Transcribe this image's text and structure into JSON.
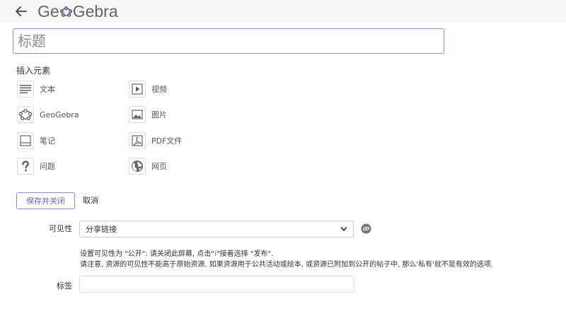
{
  "header": {
    "back_icon": "arrow-left-icon",
    "logo_left": "Ge",
    "logo_right": "Gebra",
    "logo_color": "#666666"
  },
  "title_field": {
    "placeholder": "标题",
    "value": ""
  },
  "insert_section": {
    "title": "插入元素",
    "items": [
      {
        "label": "文本",
        "icon": "text-lines-icon"
      },
      {
        "label": "视频",
        "icon": "video-play-icon"
      },
      {
        "label": "GeoGebra",
        "icon": "geogebra-icon"
      },
      {
        "label": "图片",
        "icon": "image-icon"
      },
      {
        "label": "笔记",
        "icon": "note-icon"
      },
      {
        "label": "PDF文件",
        "icon": "pdf-icon"
      },
      {
        "label": "问题",
        "icon": "question-icon"
      },
      {
        "label": "网页",
        "icon": "globe-icon"
      }
    ]
  },
  "actions": {
    "save_label": "保存并关闭",
    "cancel_label": "取消",
    "accent_color": "#6565c8"
  },
  "visibility": {
    "label": "可见性",
    "selected": "分享链接",
    "hint_line1": "设置可见性为 \"公开\": 请关闭此屏幕, 点击\"⁝\"接着选择 \"发布\".",
    "hint_line2": "请注意, 资源的可见性不能高于原始资源. 如果资源用于公共活动或绘本, 或资源已附加到公开的帖子中, 那么'私有'就不是有效的选项."
  },
  "tags": {
    "label": "标签",
    "value": ""
  }
}
